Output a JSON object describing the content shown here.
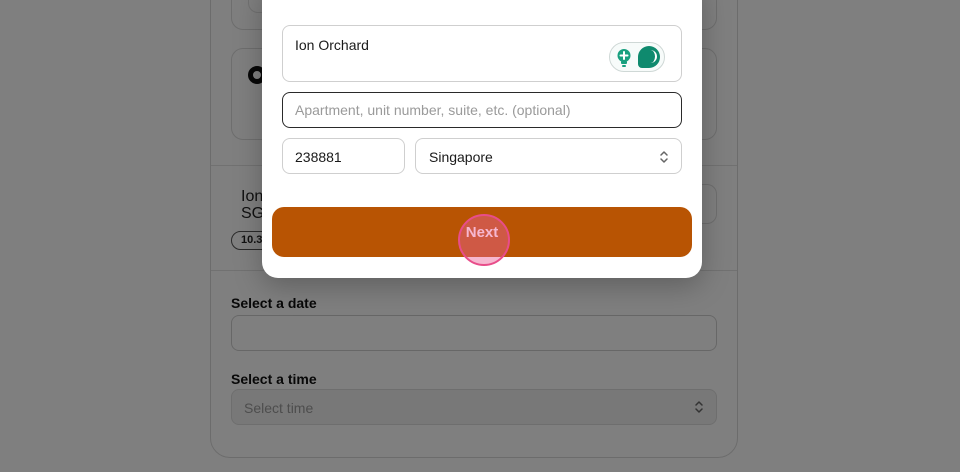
{
  "background": {
    "location": {
      "line1": "Ion",
      "line2": "SG",
      "badge": "10.3"
    },
    "date": {
      "label": "Select a date",
      "value": ""
    },
    "time": {
      "label": "Select a time",
      "placeholder": "Select time"
    }
  },
  "modal": {
    "address": {
      "value": "Ion Orchard",
      "assistant_icons": [
        "lightbulb-icon",
        "chat-bubble-icon"
      ]
    },
    "apartment": {
      "placeholder": "Apartment, unit number, suite, etc. (optional)",
      "value": ""
    },
    "postal_code": {
      "value": "238881"
    },
    "country": {
      "value": "Singapore"
    },
    "next_button": {
      "label": "Next"
    }
  },
  "colors": {
    "button": "#b85403",
    "assistant_accent": "#0f8a6e",
    "click_indicator": "#e84d8a"
  }
}
